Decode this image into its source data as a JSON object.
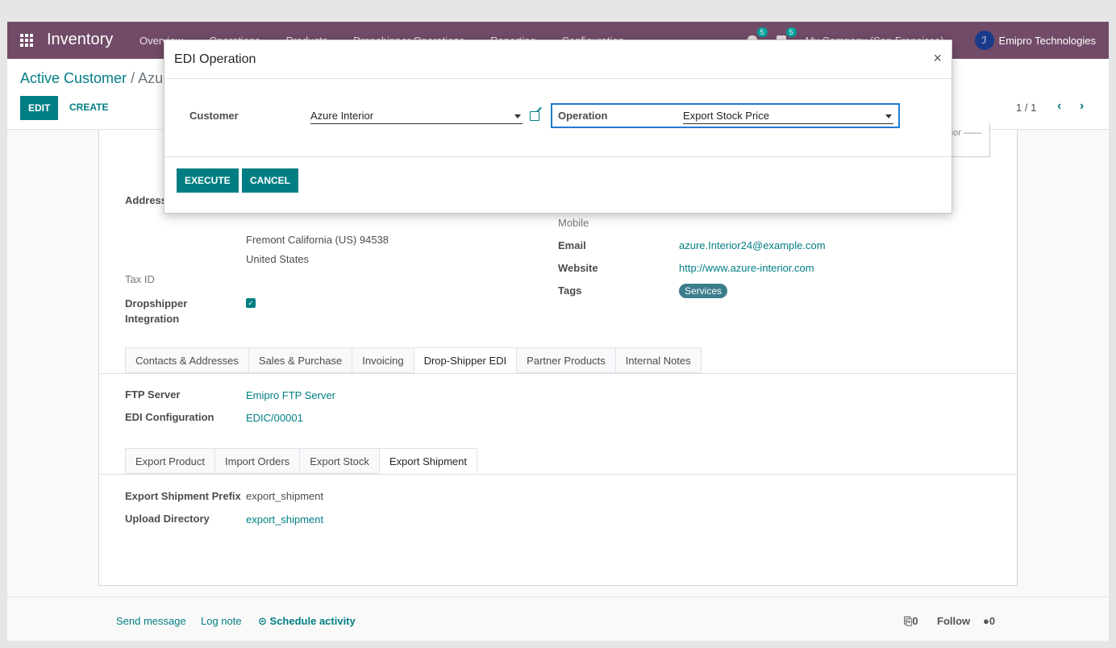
{
  "navbar": {
    "app_name": "Inventory",
    "menus": [
      "Overview",
      "Operations",
      "Products",
      "Dropshipper Operations",
      "Reporting",
      "Configuration"
    ],
    "messages_count": "5",
    "activities_count": "5",
    "company": "My Company (San Francisco)",
    "user": "Emipro Technologies"
  },
  "control_panel": {
    "breadcrumb_parent": "Active Customer",
    "breadcrumb_separator": "/",
    "breadcrumb_current": "Azu",
    "edit_label": "EDIT",
    "create_label": "CREATE",
    "pager": "1 / 1"
  },
  "form": {
    "stamp_text": "erior",
    "address_label": "Address",
    "address_line1": "Fremont  California (US)  94538",
    "address_line2": "United States",
    "tax_id_label": "Tax ID",
    "dropshipper_label_1": "Dropshipper",
    "dropshipper_label_2": "Integration",
    "mobile_label": "Mobile",
    "email_label": "Email",
    "email_value": "azure.Interior24@example.com",
    "website_label": "Website",
    "website_value": "http://www.azure-interior.com",
    "tags_label": "Tags",
    "tag_value": "Services",
    "tabs": [
      "Contacts & Addresses",
      "Sales & Purchase",
      "Invoicing",
      "Drop-Shipper EDI",
      "Partner Products",
      "Internal Notes"
    ],
    "ftp_label": "FTP Server",
    "ftp_value": "Emipro FTP Server",
    "edi_config_label": "EDI Configuration",
    "edi_config_value": "EDIC/00001",
    "subtabs": [
      "Export Product",
      "Import Orders",
      "Export Stock",
      "Export Shipment"
    ],
    "prefix_label": "Export Shipment Prefix",
    "prefix_value": "export_shipment",
    "upload_label": "Upload Directory",
    "upload_value": "export_shipment"
  },
  "chatter": {
    "send_message": "Send message",
    "log_note": "Log note",
    "schedule_activity": "Schedule activity",
    "attachments": "0",
    "follow": "Follow",
    "followers": "0"
  },
  "modal": {
    "title": "EDI Operation",
    "close": "×",
    "customer_label": "Customer",
    "customer_value": "Azure Interior",
    "operation_label": "Operation",
    "operation_value": "Export Stock Price",
    "execute_label": "EXECUTE",
    "cancel_label": "CANCEL"
  },
  "colors": {
    "navbar": "#714b67",
    "accent": "#017e84",
    "focus": "#1f7bd1"
  }
}
